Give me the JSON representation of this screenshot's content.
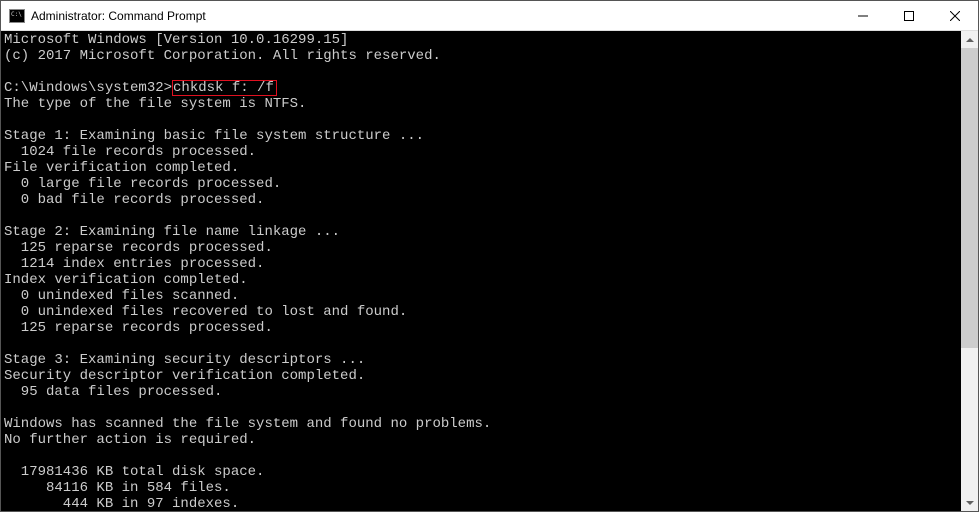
{
  "titlebar": {
    "title": "Administrator: Command Prompt"
  },
  "output": {
    "line01": "Microsoft Windows [Version 10.0.16299.15]",
    "line02": "(c) 2017 Microsoft Corporation. All rights reserved.",
    "line03": "",
    "prompt": "C:\\Windows\\system32>",
    "command": "chkdsk f: /f",
    "line04": "The type of the file system is NTFS.",
    "line05": "",
    "line06": "Stage 1: Examining basic file system structure ...",
    "line07": "  1024 file records processed.",
    "line08": "File verification completed.",
    "line09": "  0 large file records processed.",
    "line10": "  0 bad file records processed.",
    "line11": "",
    "line12": "Stage 2: Examining file name linkage ...",
    "line13": "  125 reparse records processed.",
    "line14": "  1214 index entries processed.",
    "line15": "Index verification completed.",
    "line16": "  0 unindexed files scanned.",
    "line17": "  0 unindexed files recovered to lost and found.",
    "line18": "  125 reparse records processed.",
    "line19": "",
    "line20": "Stage 3: Examining security descriptors ...",
    "line21": "Security descriptor verification completed.",
    "line22": "  95 data files processed.",
    "line23": "",
    "line24": "Windows has scanned the file system and found no problems.",
    "line25": "No further action is required.",
    "line26": "",
    "line27": "  17981436 KB total disk space.",
    "line28": "     84116 KB in 584 files.",
    "line29": "       444 KB in 97 indexes."
  }
}
